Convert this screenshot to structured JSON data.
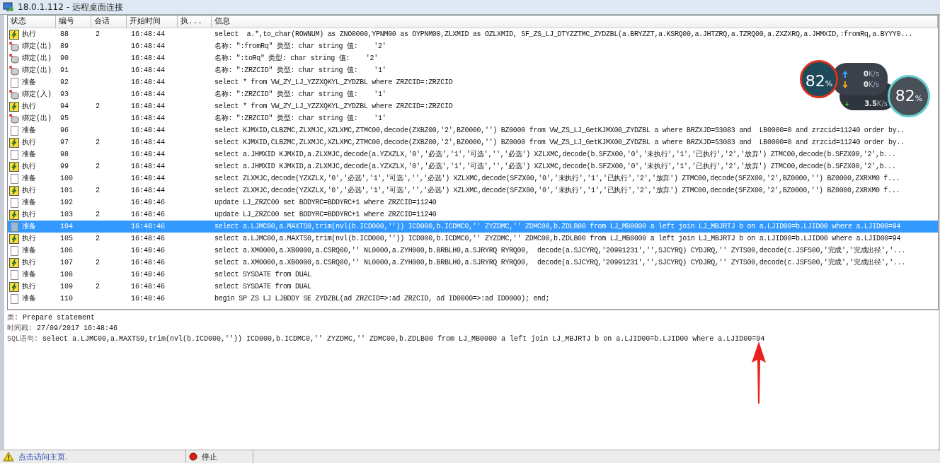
{
  "window": {
    "title": "18.0.1.112 - 远程桌面连接"
  },
  "table": {
    "columns": [
      "状态",
      "编号",
      "会话",
      "开始时间",
      "执...",
      "信息"
    ],
    "rows": [
      {
        "kind": "execute",
        "status": "执行",
        "number": "88",
        "session": "2",
        "start_time": "16:48:44",
        "info": "select  a.*,to_char(ROWNUM) as ZNO0000,YPNM00 as OYPNM00,ZLXMID as OZLXMID, SF_ZS_LJ_DTYZZTMC_ZYDZBL(a.BRYZZT,a.KSRQ00,a.JHTZRQ,a.TZRQ00,a.ZXZXRQ,a.JHMXID,:fromRq,a.BYYY0...",
        "selected": false
      },
      {
        "kind": "bind",
        "status": "绑定(出)",
        "number": "89",
        "session": "",
        "start_time": "16:48:44",
        "info": "名称: \":fromRq\" 类型: char string 值:    '2'",
        "selected": false
      },
      {
        "kind": "bind",
        "status": "绑定(出)",
        "number": "90",
        "session": "",
        "start_time": "16:48:44",
        "info": "名称: \":toRq\" 类型: char string 值:    '2'",
        "selected": false
      },
      {
        "kind": "bind",
        "status": "绑定(出)",
        "number": "91",
        "session": "",
        "start_time": "16:48:44",
        "info": "名称: \":ZRZCID\" 类型: char string 值:    '1'",
        "selected": false
      },
      {
        "kind": "prepare",
        "status": "准备",
        "number": "92",
        "session": "",
        "start_time": "16:48:44",
        "info": "select * from VW_ZY_LJ_YZZXQKYL_ZYDZBL where ZRZCID=:ZRZCID",
        "selected": false
      },
      {
        "kind": "bind",
        "status": "绑定(入)",
        "number": "93",
        "session": "",
        "start_time": "16:48:44",
        "info": "名称: \":ZRZCID\" 类型: char string 值:    '1'",
        "selected": false
      },
      {
        "kind": "execute",
        "status": "执行",
        "number": "94",
        "session": "2",
        "start_time": "16:48:44",
        "info": "select * from VW_ZY_LJ_YZZXQKYL_ZYDZBL where ZRZCID=:ZRZCID",
        "selected": false
      },
      {
        "kind": "bind",
        "status": "绑定(出)",
        "number": "95",
        "session": "",
        "start_time": "16:48:44",
        "info": "名称: \":ZRZCID\" 类型: char string 值:    '1'",
        "selected": false
      },
      {
        "kind": "prepare",
        "status": "准备",
        "number": "96",
        "session": "",
        "start_time": "16:48:44",
        "info": "select KJMXID,CLBZMC,ZLXMJC,XZLXMC,ZTMC00,decode(ZXBZ00,'2',BZ0000,'') BZ0000 from VW_ZS_LJ_GetKJMX00_ZYDZBL a where BRZXJD=53083 and  LB0000=0 and zrzcid=11240 order by..",
        "selected": false
      },
      {
        "kind": "execute",
        "status": "执行",
        "number": "97",
        "session": "2",
        "start_time": "16:48:44",
        "info": "select KJMXID,CLBZMC,ZLXMJC,XZLXMC,ZTMC00,decode(ZXBZ00,'2',BZ0000,'') BZ0000 from VW_ZS_LJ_GetKJMX00_ZYDZBL a where BRZXJD=53083 and  LB0000=0 and zrzcid=11240 order by..",
        "selected": false
      },
      {
        "kind": "prepare",
        "status": "准备",
        "number": "98",
        "session": "",
        "start_time": "16:48:44",
        "info": "select a.JHMXID KJMXID,a.ZLXMJC,decode(a.YZXZLX,'0','必选','1','可选','','必选') XZLXMC,decode(b.SFZX00,'0','未执行','1','已执行','2','放弃') ZTMC00,decode(b.SFZX00,'2',b...",
        "selected": false
      },
      {
        "kind": "execute",
        "status": "执行",
        "number": "99",
        "session": "2",
        "start_time": "16:48:44",
        "info": "select a.JHMXID KJMXID,a.ZLXMJC,decode(a.YZXZLX,'0','必选','1','可选','','必选') XZLXMC,decode(b.SFZX00,'0','未执行','1','已执行','2','放弃') ZTMC00,decode(b.SFZX00,'2',b...",
        "selected": false
      },
      {
        "kind": "prepare",
        "status": "准备",
        "number": "100",
        "session": "",
        "start_time": "16:48:44",
        "info": "select ZLXMJC,decode(YZXZLX,'0','必选','1','可选','','必选') XZLXMC,decode(SFZX00,'0','未执行','1','已执行','2','放弃') ZTMC00,decode(SFZX00,'2',BZ0000,'') BZ0000,ZXRXM0 f...",
        "selected": false
      },
      {
        "kind": "execute",
        "status": "执行",
        "number": "101",
        "session": "2",
        "start_time": "16:48:44",
        "info": "select ZLXMJC,decode(YZXZLX,'0','必选','1','可选','','必选') XZLXMC,decode(SFZX00,'0','未执行','1','已执行','2','放弃') ZTMC00,decode(SFZX00,'2',BZ0000,'') BZ0000,ZXRXM0 f...",
        "selected": false
      },
      {
        "kind": "prepare",
        "status": "准备",
        "number": "102",
        "session": "",
        "start_time": "16:48:46",
        "info": "update LJ_ZRZC00 set BDDYRC=BDDYRC+1 where ZRZCID=11240",
        "selected": false
      },
      {
        "kind": "execute",
        "status": "执行",
        "number": "103",
        "session": "2",
        "start_time": "16:48:46",
        "info": "update LJ_ZRZC00 set BDDYRC=BDDYRC+1 where ZRZCID=11240",
        "selected": false
      },
      {
        "kind": "prepare",
        "status": "准备",
        "number": "104",
        "session": "",
        "start_time": "16:48:46",
        "info": "select a.LJMC00,a.MAXTS0,trim(nvl(b.ICD000,'')) ICD000,b.ICDMC0,'' ZYZDMC,'' ZDMC00,b.ZDLB00 from LJ_MB0000 a left join LJ_MBJRTJ b on a.LJID00=b.LJID00 where a.LJID00=94",
        "selected": true
      },
      {
        "kind": "execute",
        "status": "执行",
        "number": "105",
        "session": "2",
        "start_time": "16:48:46",
        "info": "select a.LJMC00,a.MAXTS0,trim(nvl(b.ICD000,'')) ICD000,b.ICDMC0,'' ZYZDMC,'' ZDMC00,b.ZDLB00 from LJ_MB0000 a left join LJ_MBJRTJ b on a.LJID00=b.LJID00 where a.LJID00=94",
        "selected": false
      },
      {
        "kind": "prepare",
        "status": "准备",
        "number": "106",
        "session": "",
        "start_time": "16:48:46",
        "info": "select a.XM0000,a.XB0000,a.CSRQ00,'' NL0000,a.ZYH000,b.BRBLH0,a.SJRYRQ RYRQ00,  decode(a.SJCYRQ,'20991231','',SJCYRQ) CYDJRQ,'' ZYTS00,decode(c.JSFS00,'完成','完成出径','...",
        "selected": false
      },
      {
        "kind": "execute",
        "status": "执行",
        "number": "107",
        "session": "2",
        "start_time": "16:48:46",
        "info": "select a.XM0000,a.XB0000,a.CSRQ00,'' NL0000,a.ZYH000,b.BRBLH0,a.SJRYRQ RYRQ00,  decode(a.SJCYRQ,'20991231','',SJCYRQ) CYDJRQ,'' ZYTS00,decode(c.JSFS00,'完成','完成出径','...",
        "selected": false
      },
      {
        "kind": "prepare",
        "status": "准备",
        "number": "108",
        "session": "",
        "start_time": "16:48:46",
        "info": "select SYSDATE from DUAL",
        "selected": false
      },
      {
        "kind": "execute",
        "status": "执行",
        "number": "109",
        "session": "2",
        "start_time": "16:48:46",
        "info": "select SYSDATE from DUAL",
        "selected": false
      },
      {
        "kind": "prepare",
        "status": "准备",
        "number": "110",
        "session": "",
        "start_time": "16:48:46",
        "info": "begin SP ZS LJ LJBDDY SE ZYDZBL(ad ZRZCID=>:ad ZRZCID, ad ID0000=>:ad ID0000); end;",
        "selected": false
      }
    ]
  },
  "detail": {
    "fields": [
      {
        "label": "类:",
        "value": "Prepare statement"
      },
      {
        "label": "时间戳:",
        "value": "27/09/2017 16:48:46"
      },
      {
        "label": "SQL语句:",
        "value": "select a.LJMC00,a.MAXTS0,trim(nvl(b.ICD000,'')) ICD000,b.ICDMC0,'' ZYZDMC,'' ZDMC00,b.ZDLB00 from LJ_MB0000 a left join LJ_MBJRTJ b on a.LJID00=b.LJID00 where a.LJID00=94"
      }
    ]
  },
  "status_bar": {
    "link": "点击访问主页.",
    "state": "停止"
  },
  "meters": [
    {
      "percent": "82",
      "unit": "%",
      "rates": [
        {
          "kind": "up",
          "value": "0",
          "unit": "K/s"
        },
        {
          "kind": "down",
          "value": "0",
          "unit": "K/s"
        }
      ]
    },
    {
      "percent": "82",
      "unit": "%",
      "rates": [
        {
          "kind": "down",
          "value": "3.5",
          "unit": "K/s"
        }
      ]
    }
  ]
}
